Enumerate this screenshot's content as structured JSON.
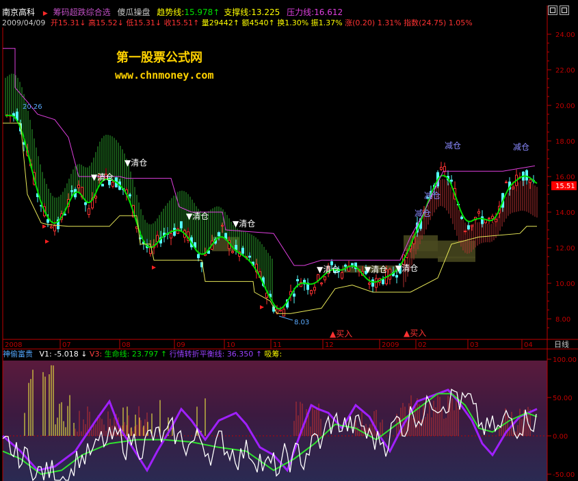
{
  "header": {
    "stock_name": "南京高科",
    "formula_name": "筹码超跌综合选",
    "formula_sub": "傻瓜操盘",
    "trend_label": "趋势线:",
    "trend_value": "15.978",
    "support_label": "支撑线:",
    "support_value": "13.225",
    "pressure_label": "压力线:",
    "pressure_value": "16.612"
  },
  "quote": {
    "date": "2009/04/09",
    "open_label": "开",
    "open": "15.31",
    "high_label": "高",
    "high": "15.52",
    "low_label": "低",
    "low": "15.31",
    "close_label": "收",
    "close": "15.51",
    "volume_label": "量",
    "volume": "29442",
    "amount_label": "额",
    "amount": "4540",
    "turnover_label": "换",
    "turnover": "1.30%",
    "amplitude_label": "振",
    "amplitude": "1.37%",
    "change_label": "涨",
    "change": "(0.20) 1.31%",
    "index_label": "指数",
    "index": "(24.75) 1.05%"
  },
  "watermark": {
    "line1": "第一股票公式网",
    "line2": "www.chnmoney.com"
  },
  "main_chart": {
    "yaxis_labels": [
      "24.00",
      "22.00",
      "20.00",
      "18.00",
      "16.00",
      "14.00",
      "12.00",
      "10.00",
      "8.00"
    ],
    "high_marker": "20.26",
    "low_marker": "8.03",
    "price_tag": "15.51",
    "signals": {
      "sell": "清仓",
      "buy": "买入",
      "reduce": "减仓"
    }
  },
  "time_axis": {
    "labels": [
      "2008",
      "07",
      "08",
      "09",
      "10",
      "11",
      "12",
      "2009",
      "02",
      "03",
      "04"
    ],
    "period": "日线"
  },
  "indicator": {
    "name": "神偷富贵",
    "v1_label": "V1:",
    "v1_value": "-5.018",
    "v3_label": "V3:",
    "life_label": "生命线:",
    "life_value": "23.797",
    "balance_label": "行情转折平衡线:",
    "balance_value": "36.350",
    "absorb_label": "吸筹:",
    "yaxis_labels": [
      "100.00",
      "50.00",
      "0.00",
      "-50.00"
    ]
  },
  "colors": {
    "up": "#ff3232",
    "down": "#54fcfc",
    "trend": "#00e000",
    "pressure": "#e040e0",
    "support": "#e8e858",
    "bg": "#000000",
    "axis": "#c00000",
    "label_yellow": "#ffff00",
    "tag": "#ff0000"
  }
}
